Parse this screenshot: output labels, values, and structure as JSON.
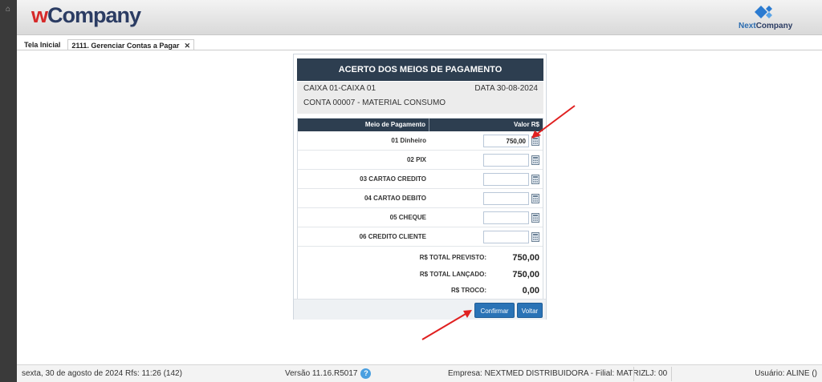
{
  "header": {
    "logo_w": "w",
    "logo_company": "Company",
    "partner_logo_prefix": "Next",
    "partner_logo_suffix": "Company"
  },
  "tabs": [
    {
      "label": "Tela Inicial"
    },
    {
      "label": "2111. Gerenciar Contas a Pagar",
      "close": "✕"
    }
  ],
  "dialog": {
    "title": "ACERTO DOS MEIOS DE PAGAMENTO",
    "caixa": "CAIXA  01-CAIXA 01",
    "data": "DATA  30-08-2024",
    "conta": "CONTA  00007 - MATERIAL CONSUMO",
    "table": {
      "col_payment": "Meio de Pagamento",
      "col_value": "Valor R$",
      "rows": [
        {
          "label": "01 Dinheiro",
          "value": "750,00"
        },
        {
          "label": "02 PIX",
          "value": ""
        },
        {
          "label": "03 CARTAO CREDITO",
          "value": ""
        },
        {
          "label": "04 CARTAO DEBITO",
          "value": ""
        },
        {
          "label": "05 CHEQUE",
          "value": ""
        },
        {
          "label": "06 CREDITO CLIENTE",
          "value": ""
        }
      ]
    },
    "totals": {
      "previsto_label": "R$ TOTAL PREVISTO:",
      "previsto_value": "750,00",
      "lancado_label": "R$ TOTAL LANÇADO:",
      "lancado_value": "750,00",
      "troco_label": "R$ TROCO:",
      "troco_value": "0,00"
    },
    "buttons": {
      "confirm": "Confirmar",
      "back": "Voltar"
    }
  },
  "status": {
    "datetime": "sexta, 30 de agosto de 2024  Rfs: 11:26 (142)",
    "version": "Versão 11.16.R5017",
    "help": "?",
    "company": "Empresa: NEXTMED DISTRIBUIDORA - Filial: MATRIZ",
    "lj": "LJ: 00",
    "user": "Usuário: ALINE ()"
  },
  "colors": {
    "dialog_header": "#2d3e50",
    "button": "#2a73b6",
    "annotation_arrow": "#e02020",
    "logo_w": "#d62a2a",
    "logo_company": "#2b3c63"
  }
}
